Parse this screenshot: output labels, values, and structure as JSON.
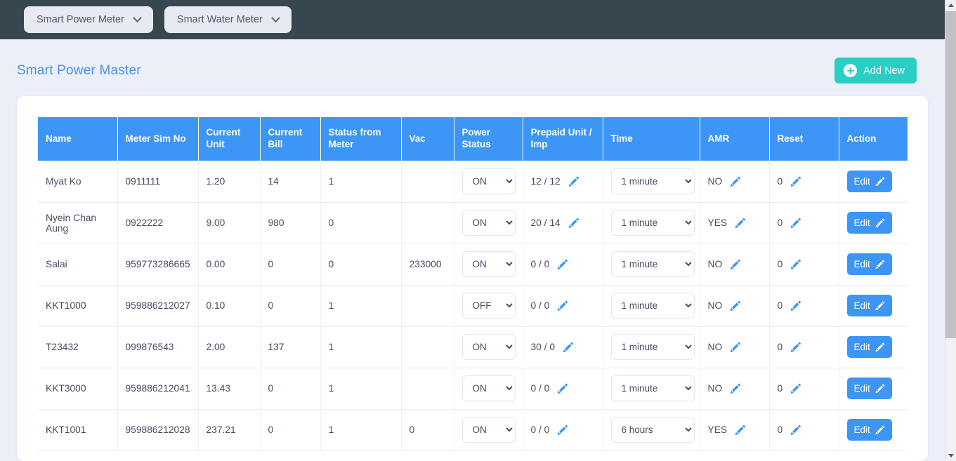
{
  "topbar": {
    "buttons": [
      {
        "label": "Smart Power Meter",
        "icon": "chevron-down-icon"
      },
      {
        "label": "Smart Water Meter",
        "icon": "chevron-down-icon"
      }
    ]
  },
  "header": {
    "title": "Smart Power Master",
    "add_new_label": "Add New",
    "add_new_icon": "plus-circle-icon",
    "accent_blue": "#3d95f5",
    "accent_teal": "#2bcec4",
    "topbar_bg": "#36474f",
    "page_bg": "#eceff8"
  },
  "table": {
    "columns": [
      "Name",
      "Meter Sim No",
      "Current Unit",
      "Current Bill",
      "Status from Meter",
      "Vac",
      "Power Status",
      "Prepaid Unit / Imp",
      "Time",
      "AMR",
      "Reset",
      "Action"
    ],
    "edit_label": "Edit",
    "edit_icon": "pen-icon",
    "power_options": [
      "ON",
      "OFF"
    ],
    "time_options": [
      "1 minute",
      "6 hours"
    ],
    "rows": [
      {
        "name": "Myat Ko",
        "sim": "0911111",
        "current_unit": "1.20",
        "current_bill": "14",
        "status_from_meter": "1",
        "vac": "",
        "power_status": "ON",
        "prepaid": "12 / 12",
        "time": "1 minute",
        "amr": "NO",
        "reset": "0",
        "action": "Edit"
      },
      {
        "name": "Nyein Chan Aung",
        "sim": "0922222",
        "current_unit": "9.00",
        "current_bill": "980",
        "status_from_meter": "0",
        "vac": "",
        "power_status": "ON",
        "prepaid": "20 / 14",
        "time": "1 minute",
        "amr": "YES",
        "reset": "0",
        "action": "Edit"
      },
      {
        "name": "Salai",
        "sim": "959773286665",
        "current_unit": "0.00",
        "current_bill": "0",
        "status_from_meter": "0",
        "vac": "233000",
        "power_status": "ON",
        "prepaid": "0 / 0",
        "time": "1 minute",
        "amr": "NO",
        "reset": "0",
        "action": "Edit"
      },
      {
        "name": "KKT1000",
        "sim": "959886212027",
        "current_unit": "0.10",
        "current_bill": "0",
        "status_from_meter": "1",
        "vac": "",
        "power_status": "OFF",
        "prepaid": "0 / 0",
        "time": "1 minute",
        "amr": "NO",
        "reset": "0",
        "action": "Edit"
      },
      {
        "name": "T23432",
        "sim": "099876543",
        "current_unit": "2.00",
        "current_bill": "137",
        "status_from_meter": "1",
        "vac": "",
        "power_status": "ON",
        "prepaid": "30 / 0",
        "time": "1 minute",
        "amr": "NO",
        "reset": "0",
        "action": "Edit"
      },
      {
        "name": "KKT3000",
        "sim": "959886212041",
        "current_unit": "13.43",
        "current_bill": "0",
        "status_from_meter": "1",
        "vac": "",
        "power_status": "ON",
        "prepaid": "0 / 0",
        "time": "1 minute",
        "amr": "NO",
        "reset": "0",
        "action": "Edit"
      },
      {
        "name": "KKT1001",
        "sim": "959886212028",
        "current_unit": "237.21",
        "current_bill": "0",
        "status_from_meter": "1",
        "vac": "0",
        "power_status": "ON",
        "prepaid": "0 / 0",
        "time": "6 hours",
        "amr": "YES",
        "reset": "0",
        "action": "Edit"
      }
    ]
  }
}
